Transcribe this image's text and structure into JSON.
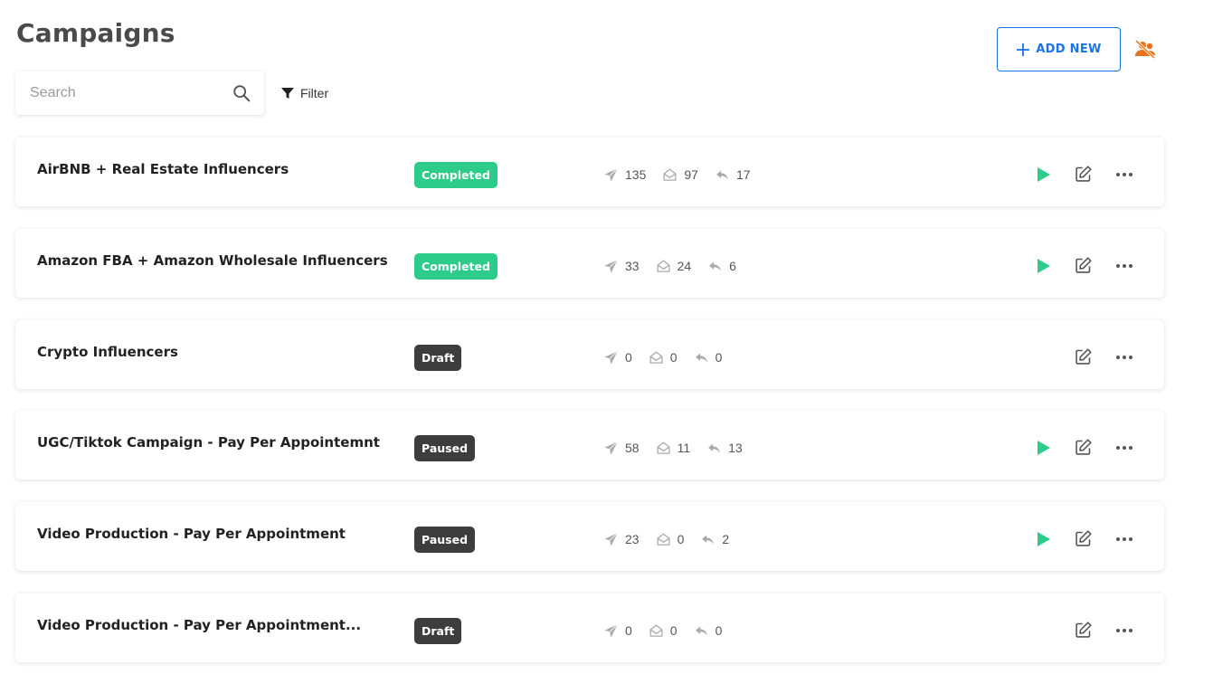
{
  "page": {
    "title": "Campaigns"
  },
  "search": {
    "placeholder": "Search",
    "value": ""
  },
  "filter": {
    "label": "Filter"
  },
  "header": {
    "add_new_label": "ADD NEW"
  },
  "colors": {
    "accent_blue": "#1a73e8",
    "completed": "#2ecc8a",
    "draft": "#3d3d3d",
    "paused": "#3d3d3d",
    "play": "#2ecc8a",
    "team_icon": "#e8731a"
  },
  "campaigns": [
    {
      "name": "AirBNB + Real Estate Influencers",
      "status": "Completed",
      "sent": "135",
      "opened": "97",
      "replied": "17",
      "show_play": true
    },
    {
      "name": "Amazon FBA + Amazon Wholesale Influencers",
      "status": "Completed",
      "sent": "33",
      "opened": "24",
      "replied": "6",
      "show_play": true
    },
    {
      "name": "Crypto Influencers",
      "status": "Draft",
      "sent": "0",
      "opened": "0",
      "replied": "0",
      "show_play": false
    },
    {
      "name": "UGC/Tiktok Campaign - Pay Per Appointemnt",
      "status": "Paused",
      "sent": "58",
      "opened": "11",
      "replied": "13",
      "show_play": true
    },
    {
      "name": "Video Production - Pay Per Appointment",
      "status": "Paused",
      "sent": "23",
      "opened": "0",
      "replied": "2",
      "show_play": true
    },
    {
      "name": "Video Production - Pay Per Appointment...",
      "status": "Draft",
      "sent": "0",
      "opened": "0",
      "replied": "0",
      "show_play": false
    }
  ]
}
